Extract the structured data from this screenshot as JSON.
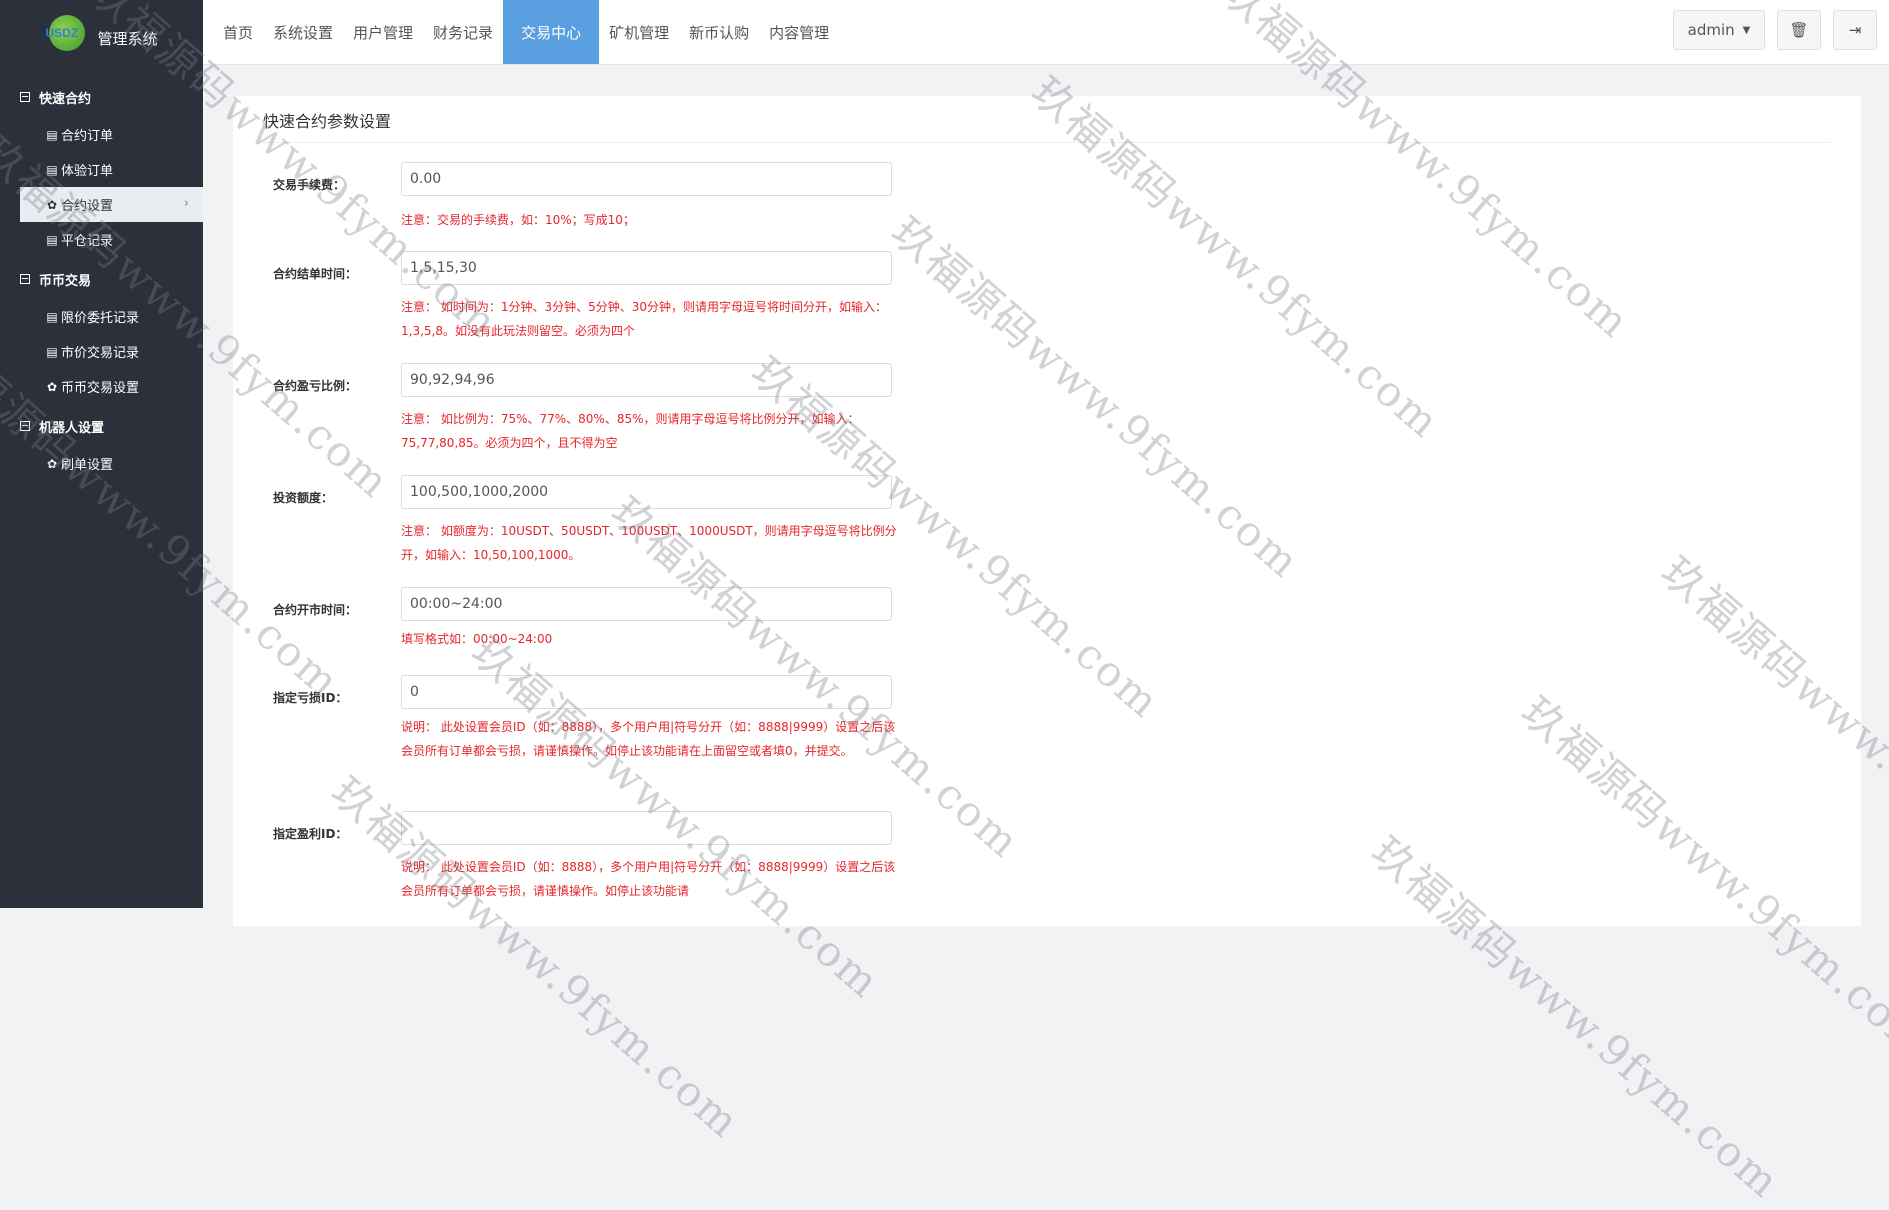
{
  "app": {
    "logo_text": "USDZ",
    "title": "管理系统"
  },
  "sidebar": {
    "groups": [
      {
        "label": "快速合约",
        "items": [
          {
            "label": "合约订单",
            "icon": "list-icon"
          },
          {
            "label": "体验订单",
            "icon": "list-icon"
          },
          {
            "label": "合约设置",
            "icon": "gear-icon",
            "active": true
          },
          {
            "label": "平仓记录",
            "icon": "list-icon"
          }
        ]
      },
      {
        "label": "币币交易",
        "items": [
          {
            "label": "限价委托记录",
            "icon": "list-icon"
          },
          {
            "label": "市价交易记录",
            "icon": "list-icon"
          },
          {
            "label": "币币交易设置",
            "icon": "gear-icon"
          }
        ]
      },
      {
        "label": "机器人设置",
        "items": [
          {
            "label": "刷单设置",
            "icon": "gear-icon"
          }
        ]
      }
    ]
  },
  "topnav": {
    "tabs": [
      "首页",
      "系统设置",
      "用户管理",
      "财务记录",
      "交易中心",
      "矿机管理",
      "新币认购",
      "内容管理"
    ],
    "active_tab": "交易中心",
    "user": "admin"
  },
  "panel": {
    "title": "快速合约参数设置",
    "fields": [
      {
        "label": "交易手续费：",
        "value": "0.00",
        "note": "注意：交易的手续费，如：10%；写成10；"
      },
      {
        "label": "合约结单时间：",
        "value": "1,5,15,30",
        "note": "注意： 如时间为：1分钟、3分钟、5分钟、30分钟，则请用字母逗号将时间分开，如输入：1,3,5,8。如没有此玩法则留空。必须为四个"
      },
      {
        "label": "合约盈亏比例：",
        "value": "90,92,94,96",
        "note": "注意： 如比例为：75%、77%、80%、85%，则请用字母逗号将比例分开，如输入：75,77,80,85。必须为四个，且不得为空"
      },
      {
        "label": "投资额度：",
        "value": "100,500,1000,2000",
        "note": "注意： 如额度为：10USDT、50USDT、100USDT、1000USDT，则请用字母逗号将比例分开，如输入：10,50,100,1000。"
      },
      {
        "label": "合约开市时间：",
        "value": "00:00~24:00",
        "note": "填写格式如：00:00~24:00"
      },
      {
        "label": "指定亏损ID：",
        "value": "0",
        "note": "说明： 此处设置会员ID（如：8888），多个用户用|符号分开（如：8888|9999）设置之后该会员所有订单都会亏损，请谨慎操作。如停止该功能请在上面留空或者填0，并提交。"
      },
      {
        "label": "指定盈利ID：",
        "value": "",
        "note": "说明： 此处设置会员ID（如：8888），多个用户用|符号分开（如：8888|9999）设置之后该会员所有订单都会亏损，请谨慎操作。如停止该功能请"
      }
    ]
  },
  "watermark": "玖福源码www.9fym.com"
}
